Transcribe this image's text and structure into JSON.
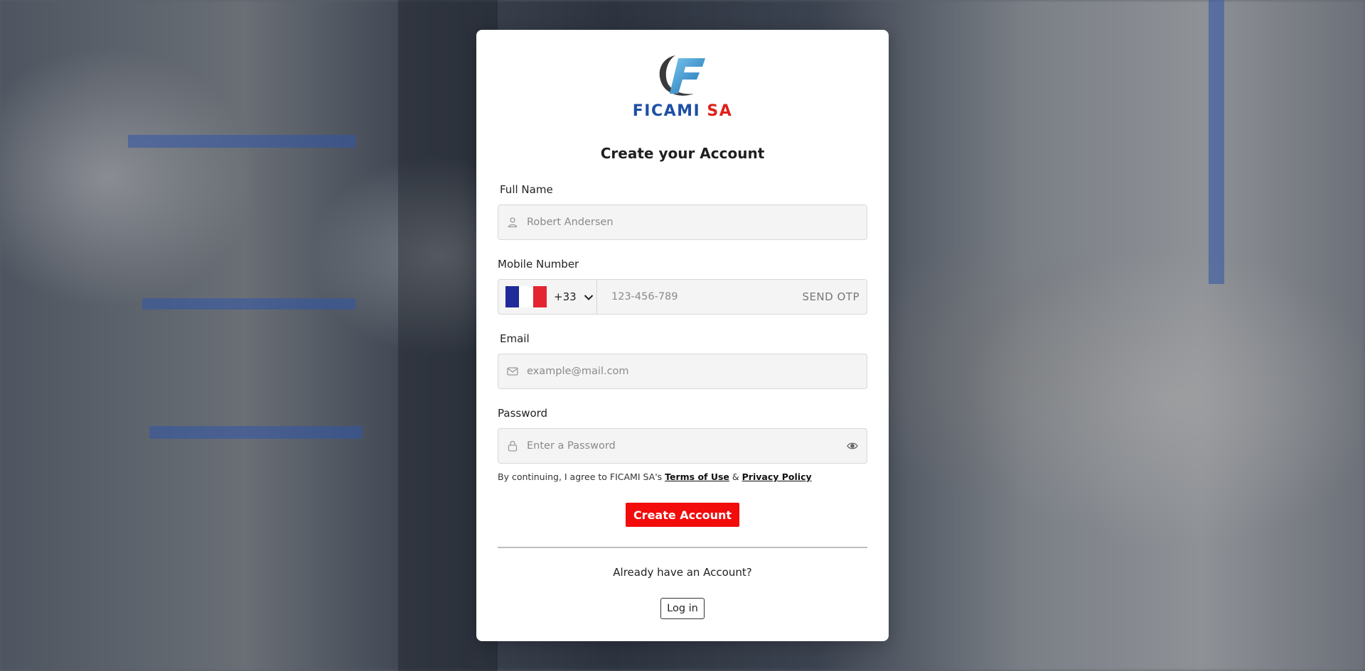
{
  "brand": {
    "name_part1": "FICAMI",
    "name_part2": "SA",
    "colors": {
      "blue": "#1e4fa3",
      "red": "#e0201b"
    }
  },
  "form": {
    "title": "Create your Account",
    "full_name": {
      "label": "Full Name",
      "placeholder": "Robert Andersen",
      "icon": "user-icon"
    },
    "mobile": {
      "label": "Mobile Number",
      "country_flag": "france-flag-icon",
      "country_code": "+33",
      "placeholder": "123-456-789",
      "otp_label": "SEND OTP"
    },
    "email": {
      "label": "Email",
      "placeholder": "example@mail.com",
      "icon": "mail-icon"
    },
    "password": {
      "label": "Password",
      "placeholder": "Enter a Password",
      "icon": "lock-icon",
      "toggle_icon": "eye-icon"
    },
    "terms": {
      "prefix": "By continuing, I agree to FICAMI SA's",
      "terms_link": "Terms of Use",
      "separator": "&",
      "privacy_link": "Privacy Policy"
    },
    "create_button": "Create Account",
    "accent_color": "#f20c0c"
  },
  "footer": {
    "already_text": "Already have an Account?",
    "login_button": "Log in"
  }
}
